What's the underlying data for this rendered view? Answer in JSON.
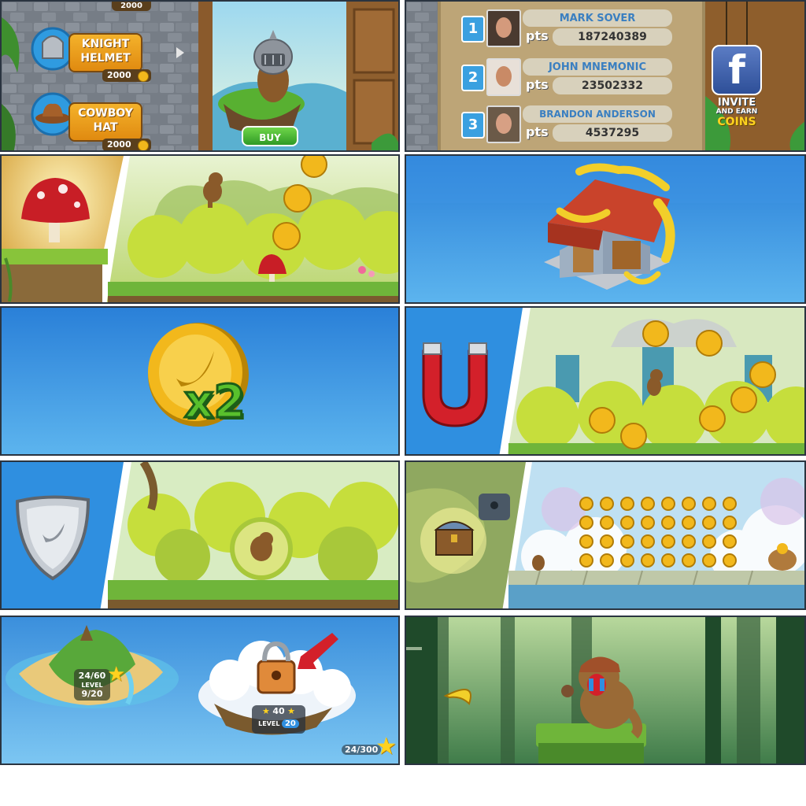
{
  "shop": {
    "price_top": "2000",
    "items": [
      {
        "name_line1": "KNIGHT",
        "name_line2": "HELMET",
        "price": "2000"
      },
      {
        "name_line1": "COWBOY",
        "name_line2": "HAT",
        "price": "2000"
      }
    ],
    "buy_label": "BUY"
  },
  "leaderboard": {
    "pts_label": "pts",
    "entries": [
      {
        "rank": "1",
        "name": "MARK SOVER",
        "score": "187240389"
      },
      {
        "rank": "2",
        "name": "JOHN MNEMONIC",
        "score": "23502332"
      },
      {
        "rank": "3",
        "name": "BRANDON ANDERSON",
        "score": "4537295"
      }
    ],
    "facebook": {
      "icon": "f",
      "line1": "INVITE",
      "line2": "AND EARN",
      "line3": "COINS"
    }
  },
  "powerups": {
    "multiplier_label": "x2"
  },
  "map": {
    "island1_progress": "24/60",
    "island1_level": "LEVEL",
    "island1_level_progress": "9/20",
    "island2_stars": "40",
    "island2_level": "LEVEL",
    "island2_level_value": "20",
    "total_stars": "24/300"
  },
  "colors": {
    "panel_blue": "#2f8fe0",
    "coin_gold": "#f2b81c",
    "leaf_green": "#9fd43a",
    "stone_gray": "#6f7780",
    "magnet_red": "#d3202a",
    "facebook_blue": "#3b5998"
  }
}
